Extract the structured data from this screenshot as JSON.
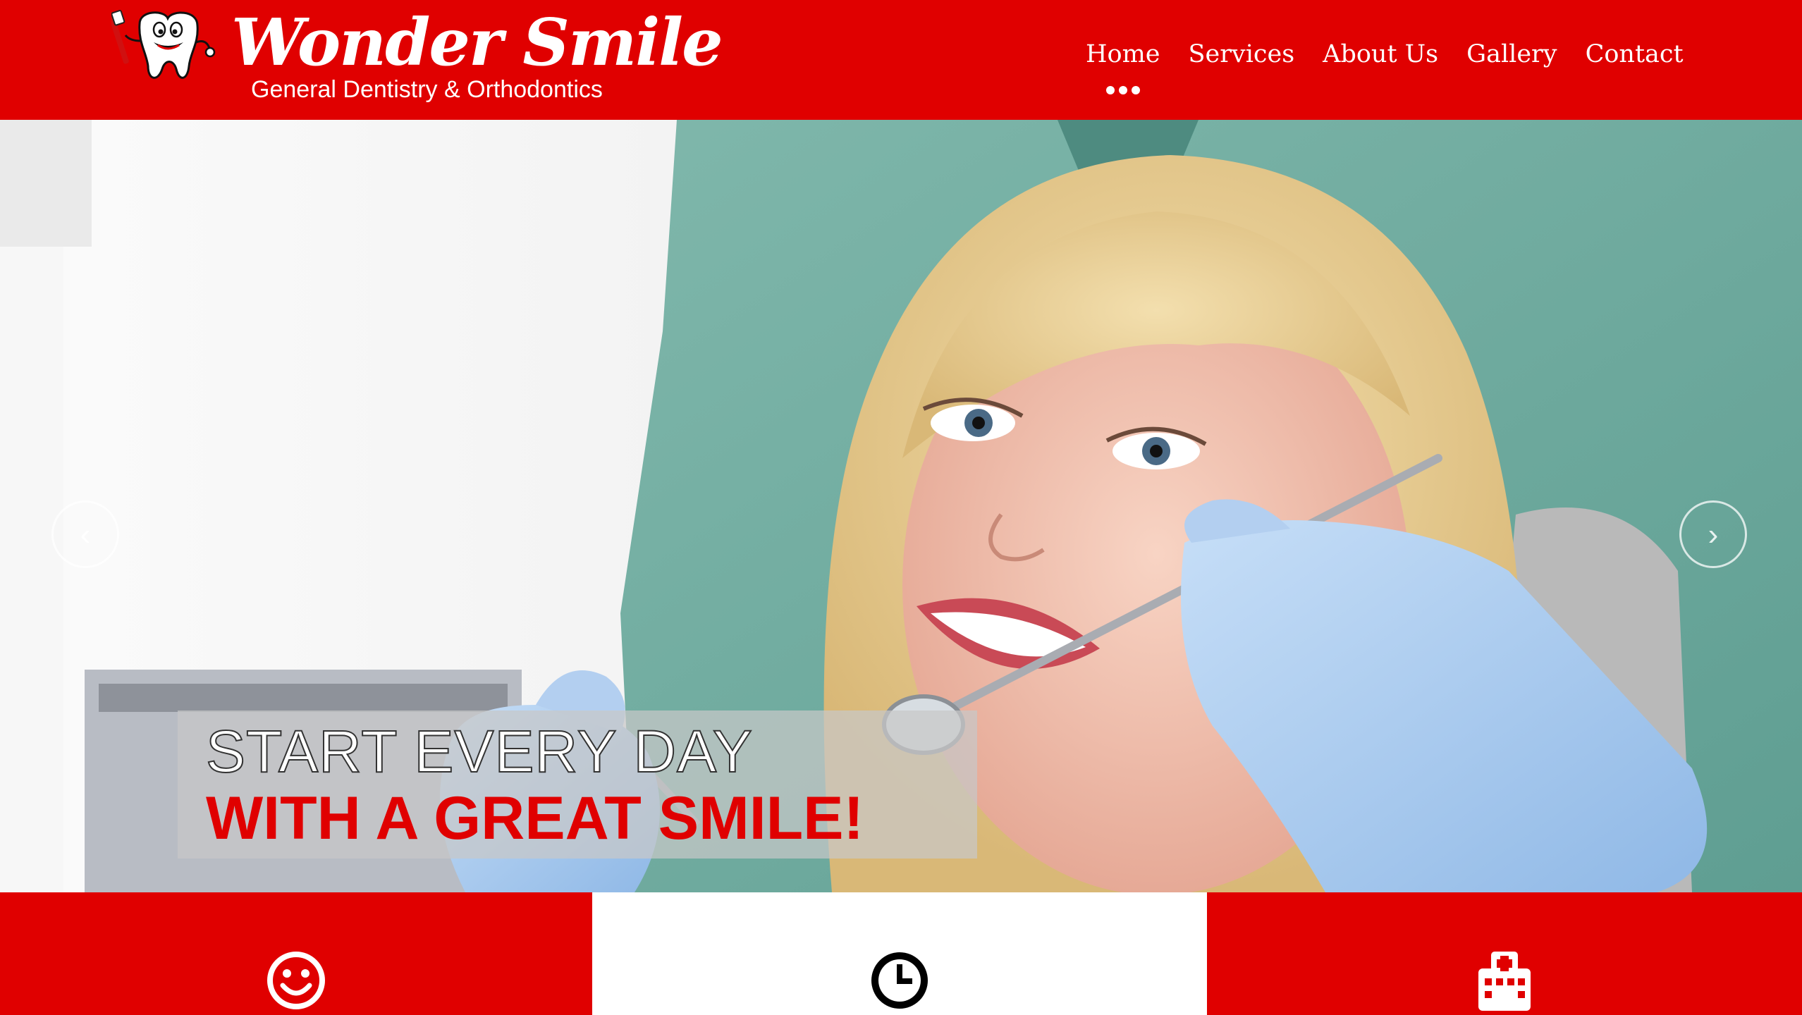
{
  "brand": {
    "name": "Wonder Smile",
    "tagline": "General Dentistry & Orthodontics"
  },
  "nav": {
    "items": [
      {
        "label": "Home",
        "active": true
      },
      {
        "label": "Services"
      },
      {
        "label": "About Us"
      },
      {
        "label": "Gallery"
      },
      {
        "label": "Contact"
      }
    ]
  },
  "hero": {
    "line1": "START EVERY DAY",
    "line2": "WITH A GREAT SMILE!",
    "prev_icon": "chevron-left-icon",
    "next_icon": "chevron-right-icon"
  },
  "features": [
    {
      "icon": "smiley-icon",
      "theme": "red"
    },
    {
      "icon": "clock-icon",
      "theme": "white"
    },
    {
      "icon": "hospital-icon",
      "theme": "red"
    }
  ],
  "colors": {
    "brand_red": "#e00000",
    "white": "#ffffff",
    "caption_bg": "#c8c8c8"
  }
}
